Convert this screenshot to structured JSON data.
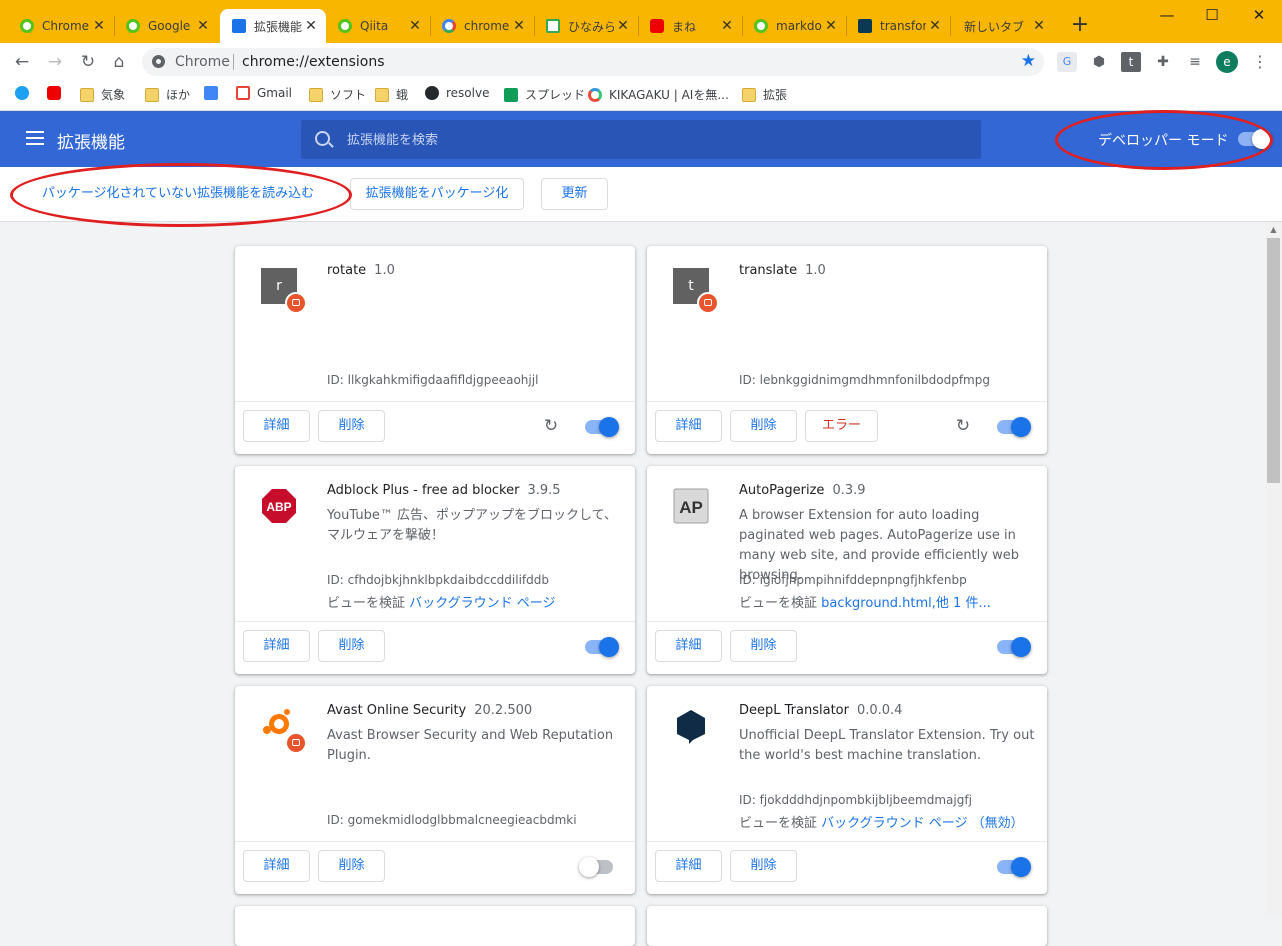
{
  "tabs": [
    {
      "title": "Chrome",
      "icon": "chrome-icon"
    },
    {
      "title": "Google",
      "icon": "chrome-icon"
    },
    {
      "title": "拡張機能",
      "icon": "puzzle-icon"
    },
    {
      "title": "Qiita",
      "icon": "chrome-icon"
    },
    {
      "title": "chrome",
      "icon": "google-icon"
    },
    {
      "title": "ひなみら",
      "icon": "play-icon"
    },
    {
      "title": "まね",
      "icon": "youtube-icon"
    },
    {
      "title": "markdo",
      "icon": "chrome-icon"
    },
    {
      "title": "transfor",
      "icon": "hf-icon"
    },
    {
      "title": "新しいタブ",
      "icon": ""
    }
  ],
  "tab_close": "✕",
  "new_tab": "+",
  "window_controls": {
    "minimize": "—",
    "maximize": "☐",
    "close": "✕"
  },
  "toolbar": {
    "back": "←",
    "forward": "→",
    "reload": "↻",
    "home": "⌂",
    "origin": "Chrome",
    "url": "chrome://extensions",
    "star": "★",
    "profile_letter": "e",
    "ext_t": "t"
  },
  "bookmarks": [
    {
      "label": "",
      "icon": "twitter-icon"
    },
    {
      "label": "",
      "icon": "youtube-icon"
    },
    {
      "label": "気象",
      "icon": "folder-icon"
    },
    {
      "label": "ほか",
      "icon": "folder-icon"
    },
    {
      "label": "",
      "icon": "translate-icon"
    },
    {
      "label": "Gmail",
      "icon": "gmail-icon"
    },
    {
      "label": "ソフト",
      "icon": "folder-icon"
    },
    {
      "label": "蛾",
      "icon": "folder-icon"
    },
    {
      "label": "resolve",
      "icon": "github-icon"
    },
    {
      "label": "スプレッド",
      "icon": "sheets-icon"
    },
    {
      "label": "KIKAGAKU | AIを無...",
      "icon": "kikagaku-icon"
    },
    {
      "label": "拡張",
      "icon": "folder-icon"
    }
  ],
  "header": {
    "title": "拡張機能",
    "search_placeholder": "拡張機能を検索",
    "dev_mode_label": "デベロッパー モード",
    "dev_mode_on": true
  },
  "actions": {
    "load_unpacked": "パッケージ化されていない拡張機能を読み込む",
    "pack": "拡張機能をパッケージ化",
    "update": "更新"
  },
  "buttons": {
    "details": "詳細",
    "remove": "削除",
    "errors": "エラー"
  },
  "extensions": [
    {
      "name": "rotate",
      "version": "1.0",
      "description": "",
      "id": "ID: llkgkahkmifigdaafifldjgpeeaohjjl",
      "inspect_label": "",
      "inspect_link": "",
      "enabled": true,
      "has_errors": false
    },
    {
      "name": "translate",
      "version": "1.0",
      "description": "",
      "id": "ID: lebnkggidnimgmdhmnfonilbdodpfmpg",
      "inspect_label": "",
      "inspect_link": "",
      "enabled": true,
      "has_errors": true
    },
    {
      "name": "Adblock Plus - free ad blocker",
      "version": "3.9.5",
      "description": "YouTube™ 広告、ポップアップをブロックして、マルウェアを撃破！",
      "id": "ID: cfhdojbkjhnklbpkdaibdccddilifddb",
      "inspect_label": "ビューを検証",
      "inspect_link": "バックグラウンド ページ",
      "enabled": true,
      "has_errors": false
    },
    {
      "name": "AutoPagerize",
      "version": "0.3.9",
      "description": "A browser Extension for auto loading paginated web pages. AutoPagerize use in many web site, and provide efficiently web browsing.",
      "id": "ID: igiofjhpmpihnifddepnpngfjhkfenbp",
      "inspect_label": "ビューを検証",
      "inspect_link": "background.html,他 1 件...",
      "enabled": true,
      "has_errors": false
    },
    {
      "name": "Avast Online Security",
      "version": "20.2.500",
      "description": "Avast Browser Security and Web Reputation Plugin.",
      "id": "ID: gomekmidlodglbbmalcneegieacbdmki",
      "inspect_label": "",
      "inspect_link": "",
      "enabled": false,
      "has_errors": false
    },
    {
      "name": "DeepL Translator",
      "version": "0.0.0.4",
      "description": "Unofficial DeepL Translator Extension. Try out the world's best machine translation.",
      "id": "ID: fjokdddhdjnpombkijbljbeemdmajgfj",
      "inspect_label": "ビューを検証",
      "inspect_link": "バックグラウンド ページ （無効）",
      "enabled": true,
      "has_errors": false
    }
  ],
  "icon_text": {
    "rotate": "r",
    "translate": "t",
    "abp": "ABP",
    "autopagerize": "AP"
  },
  "colors": {
    "accent": "#1a73e8",
    "header": "#3367d6",
    "tabbar": "#f9b600",
    "error": "#d93025",
    "annotation": "#e02020"
  }
}
